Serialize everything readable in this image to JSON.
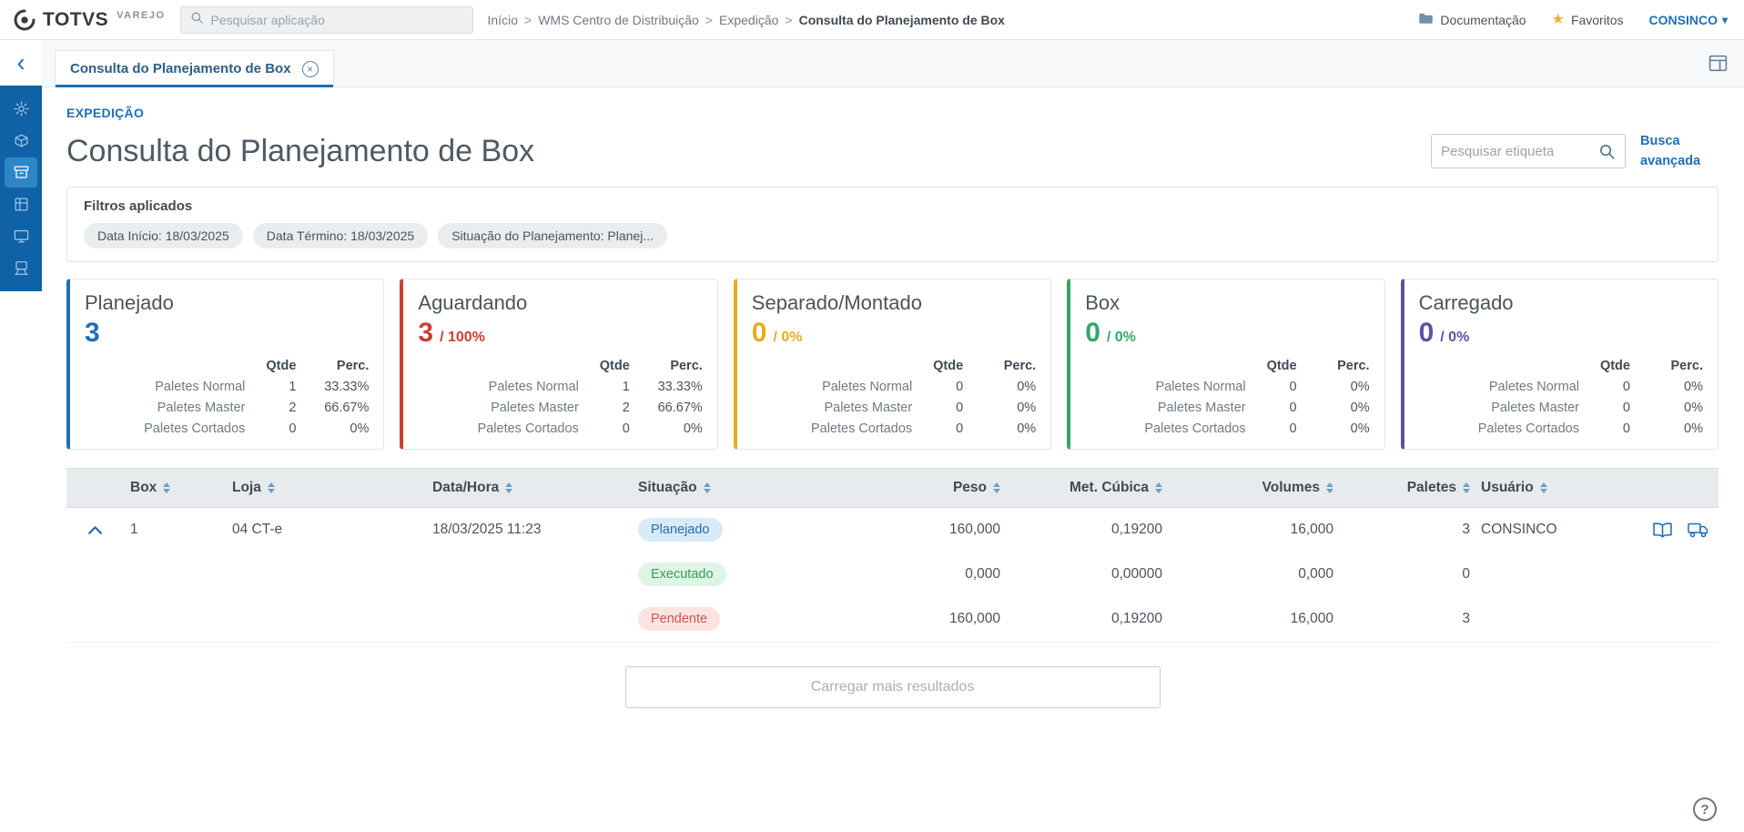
{
  "colors": {
    "primary": "#1f6fb8",
    "sidebar_bg": "#0f62a5"
  },
  "topbar": {
    "brand": "TOTVS",
    "brand_sub": "VAREJO",
    "app_search_placeholder": "Pesquisar aplicação",
    "breadcrumb": {
      "separator": ">",
      "items": [
        "Início",
        "WMS Centro de Distribuição",
        "Expedição"
      ],
      "current": "Consulta do Planejamento de Box"
    },
    "documentation_label": "Documentação",
    "favorites_label": "Favoritos",
    "user_label": "CONSINCO"
  },
  "sidebar": {
    "items": [
      "settings",
      "package",
      "box",
      "grid",
      "monitor",
      "terminal"
    ],
    "selected": "box"
  },
  "tab": {
    "label": "Consulta do Planejamento de Box"
  },
  "page": {
    "module": "EXPEDIÇÃO",
    "title": "Consulta do Planejamento de Box",
    "tag_search_placeholder": "Pesquisar etiqueta",
    "advanced_search": "Busca avançada"
  },
  "filters": {
    "title": "Filtros aplicados",
    "chips": [
      "Data Início: 18/03/2025",
      "Data Término: 18/03/2025",
      "Situação do Planejamento: Planej..."
    ]
  },
  "cards": {
    "col_qtde": "Qtde",
    "col_perc": "Perc.",
    "row_labels": [
      "Paletes Normal",
      "Paletes Master",
      "Paletes Cortados"
    ],
    "items": [
      {
        "title": "Planejado",
        "value": "3",
        "suffix": "",
        "color": "#1f6fb8",
        "rows": [
          {
            "qtde": "1",
            "perc": "33.33%"
          },
          {
            "qtde": "2",
            "perc": "66.67%"
          },
          {
            "qtde": "0",
            "perc": "0%"
          }
        ]
      },
      {
        "title": "Aguardando",
        "value": "3",
        "suffix": "/ 100%",
        "color": "#cc3f33",
        "rows": [
          {
            "qtde": "1",
            "perc": "33.33%"
          },
          {
            "qtde": "2",
            "perc": "66.67%"
          },
          {
            "qtde": "0",
            "perc": "0%"
          }
        ]
      },
      {
        "title": "Separado/Montado",
        "value": "0",
        "suffix": "/ 0%",
        "color": "#e5ad1c",
        "rows": [
          {
            "qtde": "0",
            "perc": "0%"
          },
          {
            "qtde": "0",
            "perc": "0%"
          },
          {
            "qtde": "0",
            "perc": "0%"
          }
        ]
      },
      {
        "title": "Box",
        "value": "0",
        "suffix": "/ 0%",
        "color": "#36a566",
        "rows": [
          {
            "qtde": "0",
            "perc": "0%"
          },
          {
            "qtde": "0",
            "perc": "0%"
          },
          {
            "qtde": "0",
            "perc": "0%"
          }
        ]
      },
      {
        "title": "Carregado",
        "value": "0",
        "suffix": "/ 0%",
        "color": "#6250a3",
        "rows": [
          {
            "qtde": "0",
            "perc": "0%"
          },
          {
            "qtde": "0",
            "perc": "0%"
          },
          {
            "qtde": "0",
            "perc": "0%"
          }
        ]
      }
    ]
  },
  "table": {
    "headers": [
      "Box",
      "Loja",
      "Data/Hora",
      "Situação",
      "Peso",
      "Met. Cúbica",
      "Volumes",
      "Paletes",
      "Usuário"
    ],
    "rows": [
      {
        "box": "1",
        "loja": "04 CT-e",
        "datahora": "18/03/2025 11:23",
        "situacao": "Planejado",
        "badge": {
          "bg": "#d9ebf9",
          "fg": "#1f6fb8"
        },
        "peso": "160,000",
        "cubica": "0,19200",
        "volumes": "16,000",
        "paletes": "3",
        "usuario": "CONSINCO"
      },
      {
        "box": "",
        "loja": "",
        "datahora": "",
        "situacao": "Executado",
        "badge": {
          "bg": "#def5e5",
          "fg": "#2f9e5f"
        },
        "peso": "0,000",
        "cubica": "0,00000",
        "volumes": "0,000",
        "paletes": "0",
        "usuario": ""
      },
      {
        "box": "",
        "loja": "",
        "datahora": "",
        "situacao": "Pendente",
        "badge": {
          "bg": "#fbe3e2",
          "fg": "#c75751"
        },
        "peso": "160,000",
        "cubica": "0,19200",
        "volumes": "16,000",
        "paletes": "3",
        "usuario": ""
      }
    ]
  },
  "load_more_label": "Carregar mais resultados",
  "help_label": "?"
}
